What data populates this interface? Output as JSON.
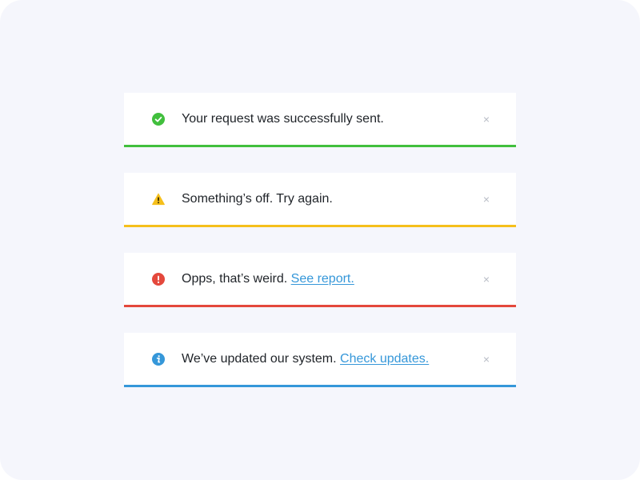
{
  "colors": {
    "page_background": "#f5f6fc",
    "success": "#41bf3d",
    "warning": "#f5bf1b",
    "error": "#e4483c",
    "info": "#3597d9",
    "text": "#1f2328",
    "close": "#b8bcc6"
  },
  "alerts": [
    {
      "type": "success",
      "icon": "check-circle-icon",
      "message": "Your request was successfully sent.",
      "link": "",
      "close": "×"
    },
    {
      "type": "warning",
      "icon": "warning-triangle-icon",
      "message": "Something’s off. Try again.",
      "link": "",
      "close": "×"
    },
    {
      "type": "error",
      "icon": "exclamation-circle-icon",
      "message": "Opps, that’s weird. ",
      "link": "See report.",
      "close": "×"
    },
    {
      "type": "info",
      "icon": "info-circle-icon",
      "message": "We’ve updated our system. ",
      "link": "Check updates.",
      "close": "×"
    }
  ]
}
